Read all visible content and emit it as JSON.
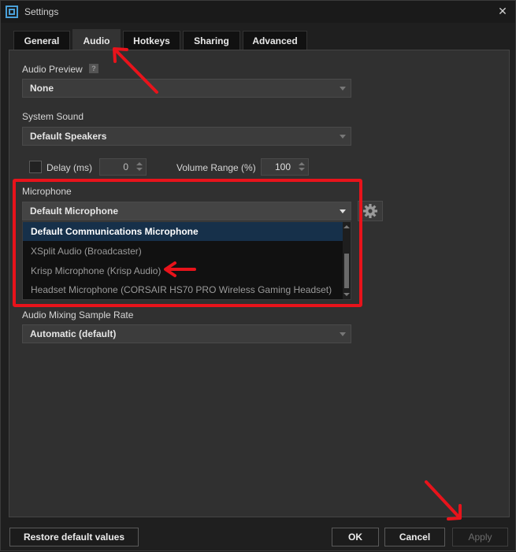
{
  "window": {
    "title": "Settings"
  },
  "tabs": [
    {
      "label": "General"
    },
    {
      "label": "Audio"
    },
    {
      "label": "Hotkeys"
    },
    {
      "label": "Sharing"
    },
    {
      "label": "Advanced"
    }
  ],
  "active_tab": "Audio",
  "audio_preview": {
    "label": "Audio Preview",
    "help": "?",
    "value": "None"
  },
  "system_sound": {
    "label": "System Sound",
    "value": "Default Speakers"
  },
  "delay": {
    "label": "Delay (ms)",
    "value": "0",
    "checked": false
  },
  "volume_range": {
    "label": "Volume Range (%)",
    "value": "100"
  },
  "microphone": {
    "label": "Microphone",
    "value": "Default Microphone",
    "options": [
      "Default Communications Microphone",
      "XSplit Audio (Broadcaster)",
      "Krisp Microphone (Krisp Audio)",
      "Headset Microphone (CORSAIR HS70 PRO Wireless Gaming Headset)"
    ],
    "highlighted_option": "Default Communications Microphone"
  },
  "sample_rate": {
    "label": "Audio Mixing Sample Rate",
    "value": "Automatic (default)"
  },
  "footer": {
    "restore_label": "Restore default values",
    "ok_label": "OK",
    "cancel_label": "Cancel",
    "apply_label": "Apply"
  },
  "colors": {
    "annotation_red": "#e8131b",
    "selection_blue": "#16304a"
  }
}
